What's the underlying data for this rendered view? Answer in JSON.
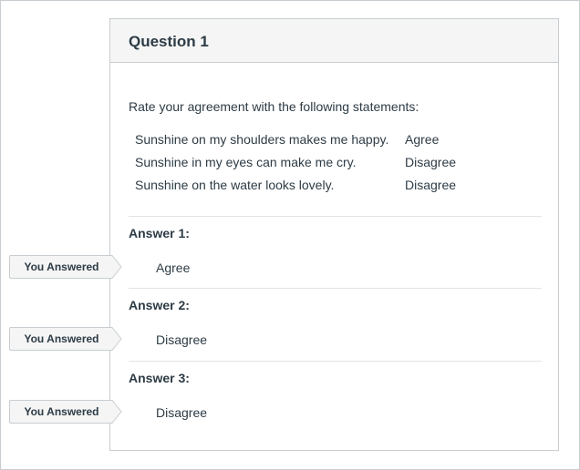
{
  "question": {
    "title": "Question 1",
    "prompt": "Rate your agreement with the following statements:",
    "statements": [
      {
        "text": "Sunshine on my shoulders makes me happy.",
        "answer": "Agree"
      },
      {
        "text": "Sunshine in my eyes can make me cry.",
        "answer": "Disagree"
      },
      {
        "text": "Sunshine on the water looks lovely.",
        "answer": "Disagree"
      }
    ]
  },
  "answers": [
    {
      "label": "Answer 1:",
      "tag": "You Answered",
      "value": "Agree"
    },
    {
      "label": "Answer 2:",
      "tag": "You Answered",
      "value": "Disagree"
    },
    {
      "label": "Answer 3:",
      "tag": "You Answered",
      "value": "Disagree"
    }
  ],
  "colors": {
    "text": "#2d3b45",
    "border": "#c7cdd1",
    "header_bg": "#f5f5f5",
    "tag_bg": "#f5f5f5"
  }
}
